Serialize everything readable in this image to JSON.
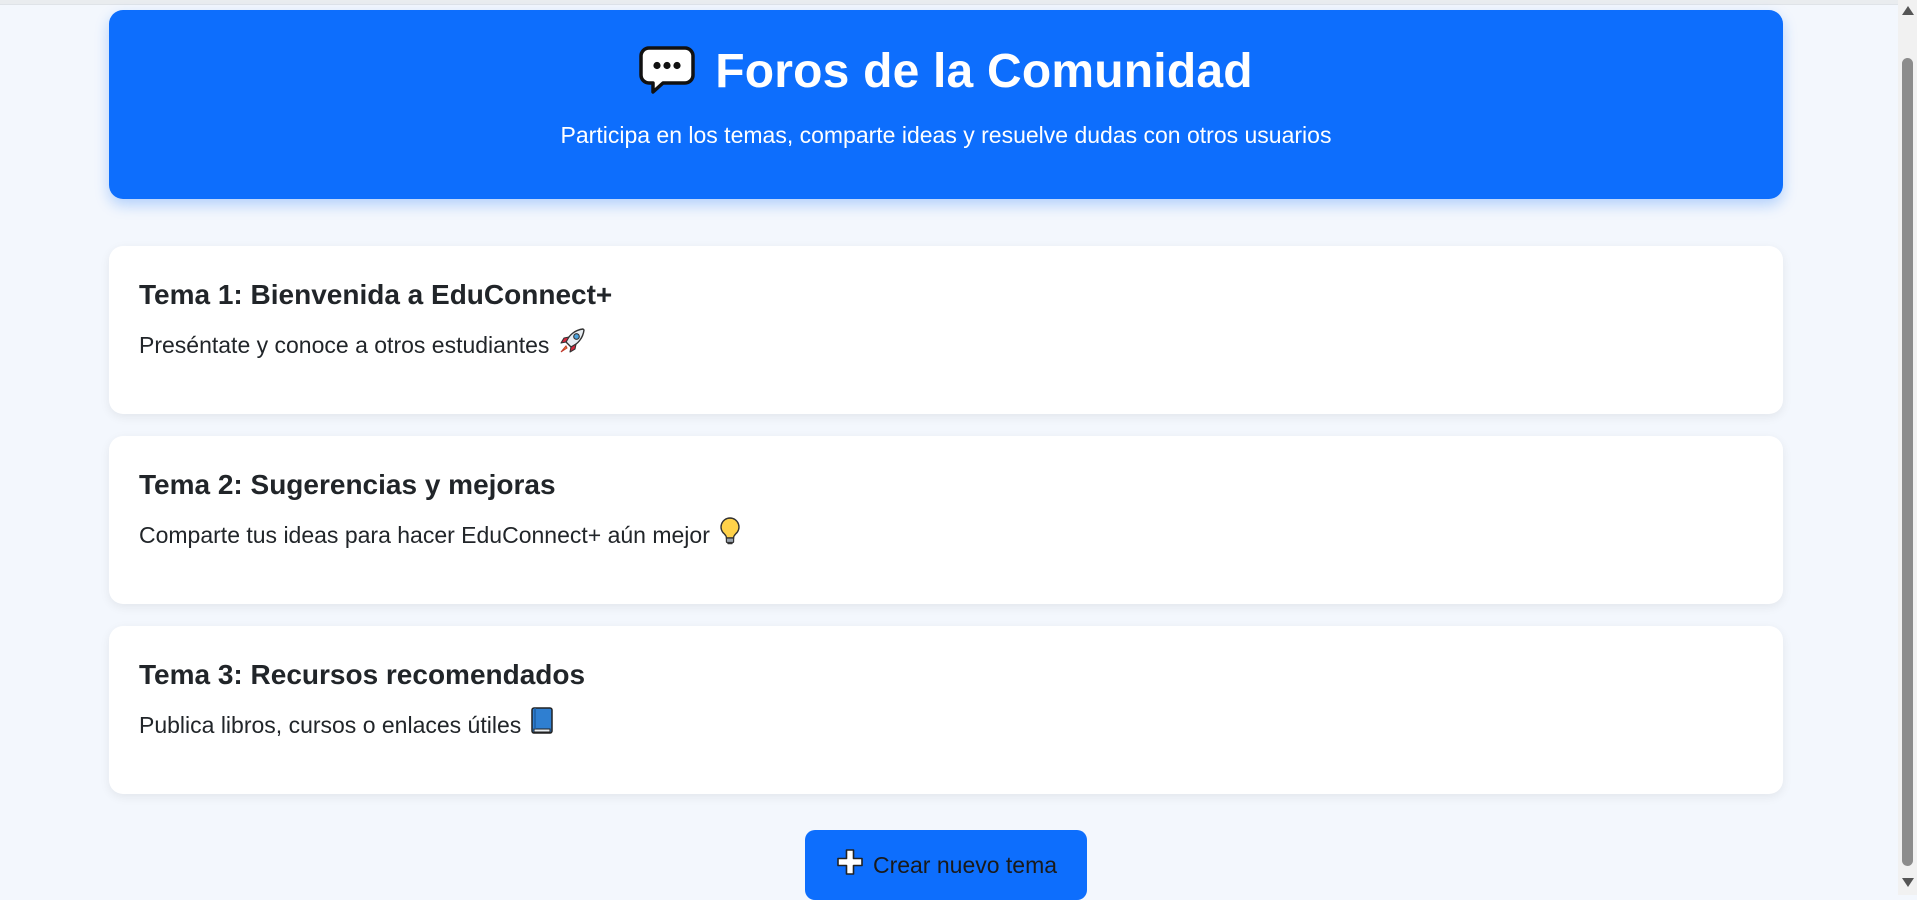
{
  "header": {
    "icon": "speech-bubble-icon",
    "title": "Foros de la Comunidad",
    "subtitle": "Participa en los temas, comparte ideas y resuelve dudas con otros usuarios"
  },
  "topics": [
    {
      "title": "Tema 1: Bienvenida a EduConnect+",
      "description": "Preséntate y conoce a otros estudiantes",
      "icon": "rocket-icon"
    },
    {
      "title": "Tema 2: Sugerencias y mejoras",
      "description": "Comparte tus ideas para hacer EduConnect+ aún mejor",
      "icon": "light-bulb-icon"
    },
    {
      "title": "Tema 3: Recursos recomendados",
      "description": "Publica libros, cursos o enlaces útiles",
      "icon": "blue-book-icon"
    }
  ],
  "actions": {
    "create_label": "Crear nuevo tema",
    "create_icon": "plus-icon"
  },
  "colors": {
    "primary": "#0d6efd",
    "background": "#f3f7fd",
    "card": "#ffffff",
    "text": "#212529"
  }
}
